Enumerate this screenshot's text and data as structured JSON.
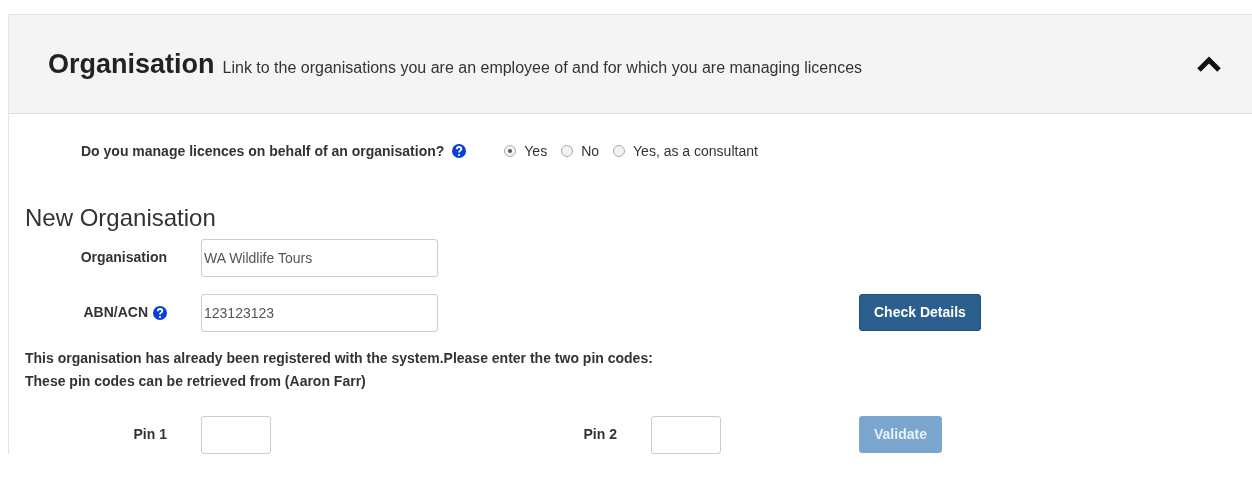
{
  "panel": {
    "title": "Organisation",
    "subtitle": "Link to the organisations you are an employee of and for which you are managing licences",
    "expanded": true
  },
  "question": {
    "label": "Do you manage licences on behalf of an organisation?",
    "options": [
      {
        "label": "Yes",
        "selected": true
      },
      {
        "label": "No",
        "selected": false
      },
      {
        "label": "Yes, as a consultant",
        "selected": false
      }
    ]
  },
  "section_title": "New Organisation",
  "organisation": {
    "label": "Organisation",
    "value": "WA Wildlife Tours"
  },
  "abn": {
    "label": "ABN/ACN",
    "value": "123123123"
  },
  "check_button": {
    "label": "Check Details",
    "disabled": false
  },
  "messages": [
    "This organisation has already been registered with the system.Please enter the two pin codes:",
    "These pin codes can be retrieved from (Aaron Farr)"
  ],
  "pins": [
    {
      "label": "Pin 1"
    },
    {
      "label": "Pin 2"
    }
  ],
  "validate_button": {
    "label": "Validate",
    "disabled": true
  }
}
